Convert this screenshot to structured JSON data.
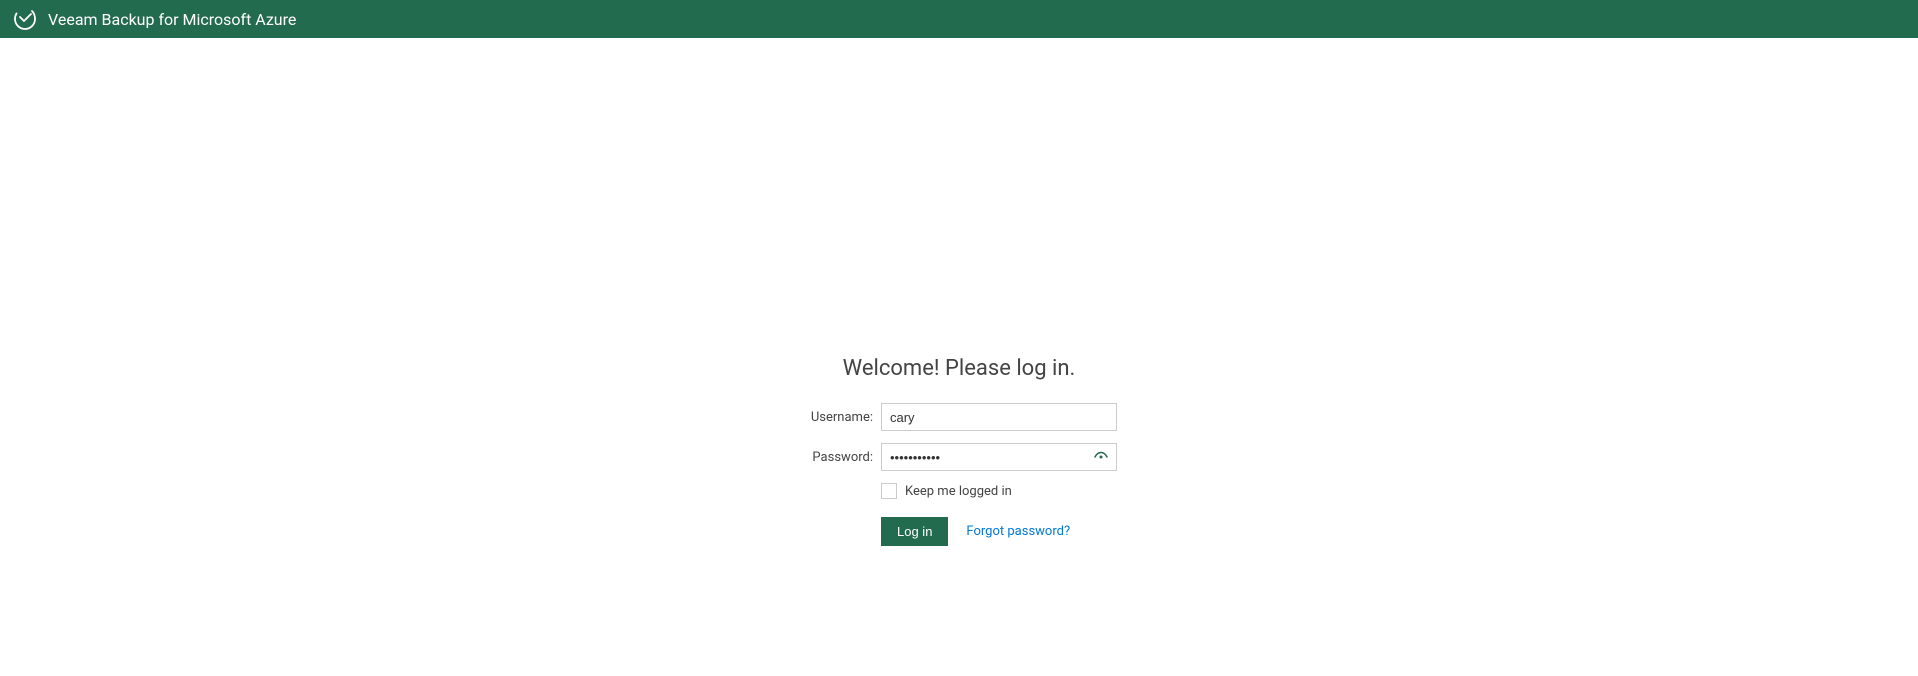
{
  "header": {
    "title": "Veeam Backup for Microsoft Azure"
  },
  "login": {
    "welcome": "Welcome! Please log in.",
    "username_label": "Username:",
    "username_value": "cary",
    "password_label": "Password:",
    "password_value": "•••••••••••",
    "keep_logged_in_label": "Keep me logged in",
    "login_button": "Log in",
    "forgot_password": "Forgot password?"
  }
}
